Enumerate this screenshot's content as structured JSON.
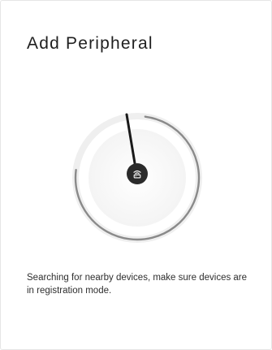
{
  "page": {
    "title": "Add Peripheral",
    "status_text": "Searching for nearby devices, make sure devices are in registration mode."
  },
  "scanner": {
    "progress": 0.75,
    "icon": "router-icon"
  },
  "colors": {
    "ring_track": "#efefef",
    "ring_arc": "#8a8a8a",
    "sweep_line": "#1a1a1a",
    "center_button": "#2b2b2b",
    "title_text": "#1f1f1f"
  }
}
